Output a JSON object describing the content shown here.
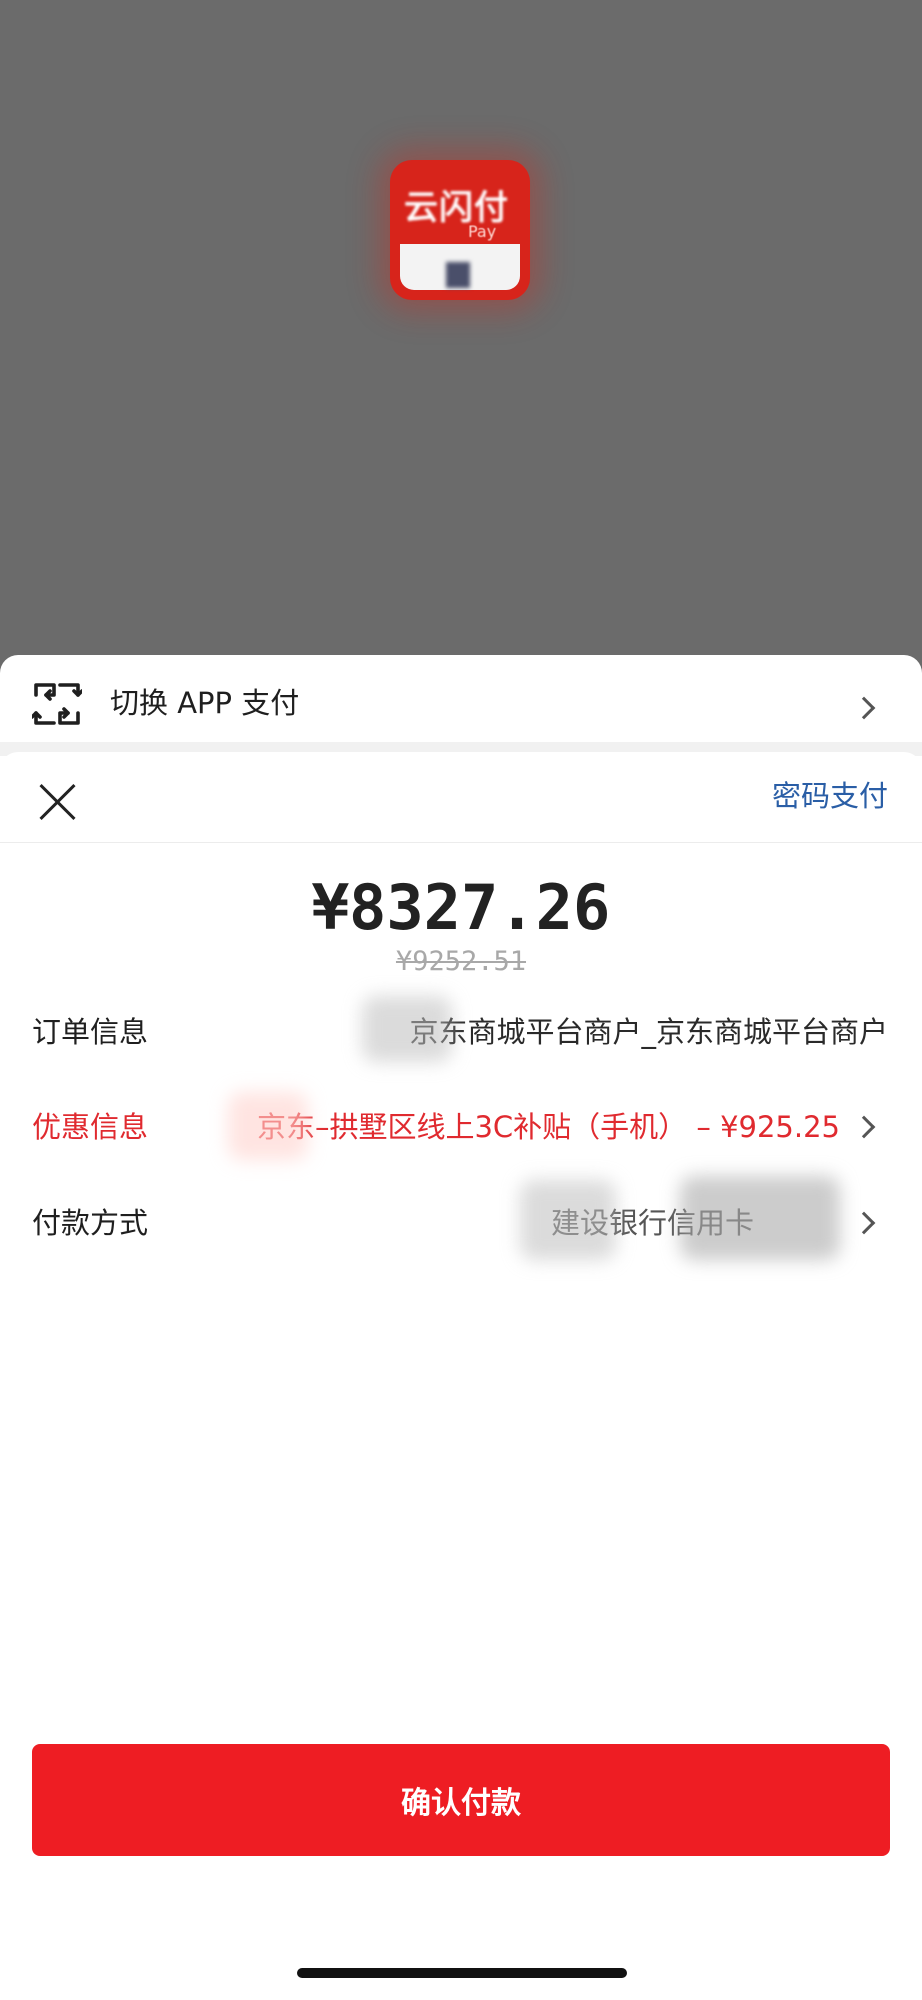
{
  "app": {
    "icon_name": "unionpay-app-icon",
    "icon_text": "云闪付",
    "icon_subtext": "Pay"
  },
  "switch_bar": {
    "icon": "switch-app-icon",
    "label": "切换 APP 支付"
  },
  "payment_sheet": {
    "close_icon": "close-icon",
    "password_pay_label": "密码支付",
    "amount": "¥8327.26",
    "original_amount": "¥9252.51",
    "rows": [
      {
        "label": "订单信息",
        "value": "京东商城平台商户_京东商城平台商户",
        "emphasis": false
      },
      {
        "label": "优惠信息",
        "value": "京东–拱墅区线上3C补贴（手机） – ¥925.25",
        "emphasis": true
      },
      {
        "label": "付款方式",
        "value": "建设银行信用卡",
        "emphasis": false
      }
    ],
    "confirm_label": "确认付款"
  },
  "colors": {
    "accent_red": "#ee1d23",
    "link_blue": "#2a5ea6",
    "overlay_gray": "#6b6b6b"
  }
}
